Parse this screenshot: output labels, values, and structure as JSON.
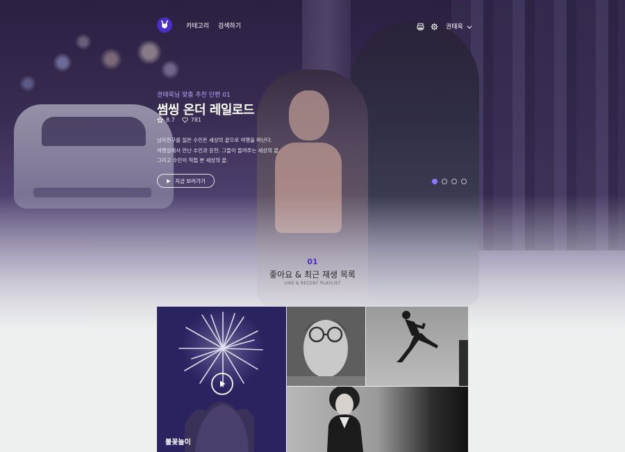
{
  "header": {
    "nav": [
      "카테고리",
      "검색하기"
    ],
    "user_name": "권태욱"
  },
  "hero": {
    "subtitle": "권태욱님 맞춤 추천 단편 01",
    "title": "썸씽 온더 레일로드",
    "rating": "8.7",
    "likes": "781",
    "description": [
      "남자친구를 잃은 수민은 세상의 끝으로 여행을 떠난다.",
      "여행길에서 만난 수민과 윤헌. 그들이 들려주는 세상의 끝.",
      "그리고 수민이 직접 본 세상의 끝."
    ],
    "watch_label": "지금 보러가기",
    "slides_total": 4,
    "slide_active": 1
  },
  "section": {
    "number": "01",
    "title": "좋아요 & 최근 재생 목록",
    "subtitle": "LIKE & RECENT PLAYLIST"
  },
  "playlist": {
    "featured_caption": "불꽃놀이"
  },
  "colors": {
    "accent": "#4a2fc7",
    "accent_light": "#8e79ff"
  }
}
